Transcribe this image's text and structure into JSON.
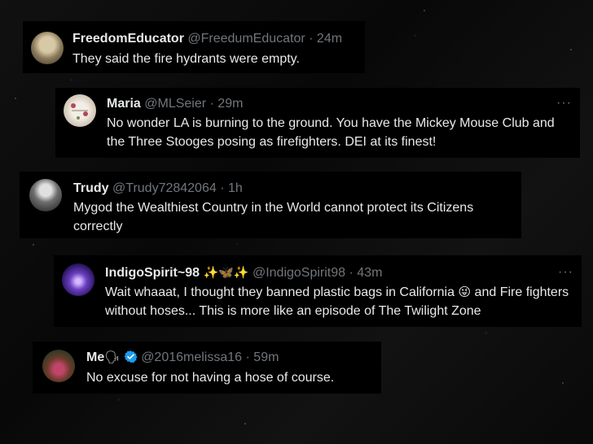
{
  "tweets": [
    {
      "name": "FreedomEducator",
      "handle": "@FreedumEducator",
      "time": "· 24m",
      "text": "They said the fire hydrants were empty."
    },
    {
      "name": "Maria",
      "handle": "@MLSeier",
      "time": "· 29m",
      "text": "No wonder LA is burning to the ground. You have the Mickey Mouse Club and the Three Stooges posing as firefighters. DEI at its finest!",
      "more": "···"
    },
    {
      "name": "Trudy",
      "handle": "@Trudy72842064",
      "time": "· 1h",
      "text": "Mygod the Wealthiest Country in the World cannot protect its Citizens correctly"
    },
    {
      "name": "IndigoSpirit~98",
      "name_emoji": "✨🦋✨",
      "handle": "@IndigoSpirit98",
      "time": "· 43m",
      "text_a": "Wait whaaat, I thought they banned plastic bags in California",
      "text_emoji": "😜",
      "text_b": "and Fire fighters without hoses...  This is more like an episode of The Twilight Zone",
      "more": "···"
    },
    {
      "name": "Me",
      "name_emoji": "🗣",
      "handle": "@2016melissa16",
      "time": "· 59m",
      "text": "No excuse for not having a hose of course."
    }
  ],
  "colors": {
    "card_bg": "#000000",
    "name": "#e7e9ea",
    "meta": "#71767b",
    "verified": "#1d9bf0"
  }
}
